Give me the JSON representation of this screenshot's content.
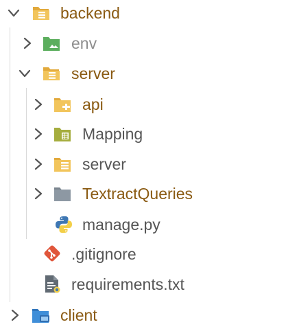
{
  "explorer": {
    "items": [
      {
        "label": "backend",
        "type": "folder-open",
        "icon": "folder-open-icon",
        "color": "#8a5a12"
      },
      {
        "label": "env",
        "type": "folder-closed",
        "icon": "folder-env-icon",
        "color": "#8e8e8e"
      },
      {
        "label": "server",
        "type": "folder-open",
        "icon": "folder-open-icon",
        "color": "#8a5a12"
      },
      {
        "label": "api",
        "type": "folder-closed",
        "icon": "folder-api-icon",
        "color": "#8a5a12"
      },
      {
        "label": "Mapping",
        "type": "folder-closed",
        "icon": "folder-mapping-icon",
        "color": "#555555"
      },
      {
        "label": "server",
        "type": "folder-closed",
        "icon": "folder-server-icon",
        "color": "#555555"
      },
      {
        "label": "TextractQueries",
        "type": "folder-closed",
        "icon": "folder-icon",
        "color": "#8a5a12"
      },
      {
        "label": "manage.py",
        "type": "file",
        "icon": "python-icon",
        "color": "#555555"
      },
      {
        "label": ".gitignore",
        "type": "file",
        "icon": "git-icon",
        "color": "#555555"
      },
      {
        "label": "requirements.txt",
        "type": "file",
        "icon": "text-file-icon",
        "color": "#555555"
      },
      {
        "label": "client",
        "type": "folder-closed",
        "icon": "folder-client-icon",
        "color": "#8a5a12"
      }
    ]
  }
}
